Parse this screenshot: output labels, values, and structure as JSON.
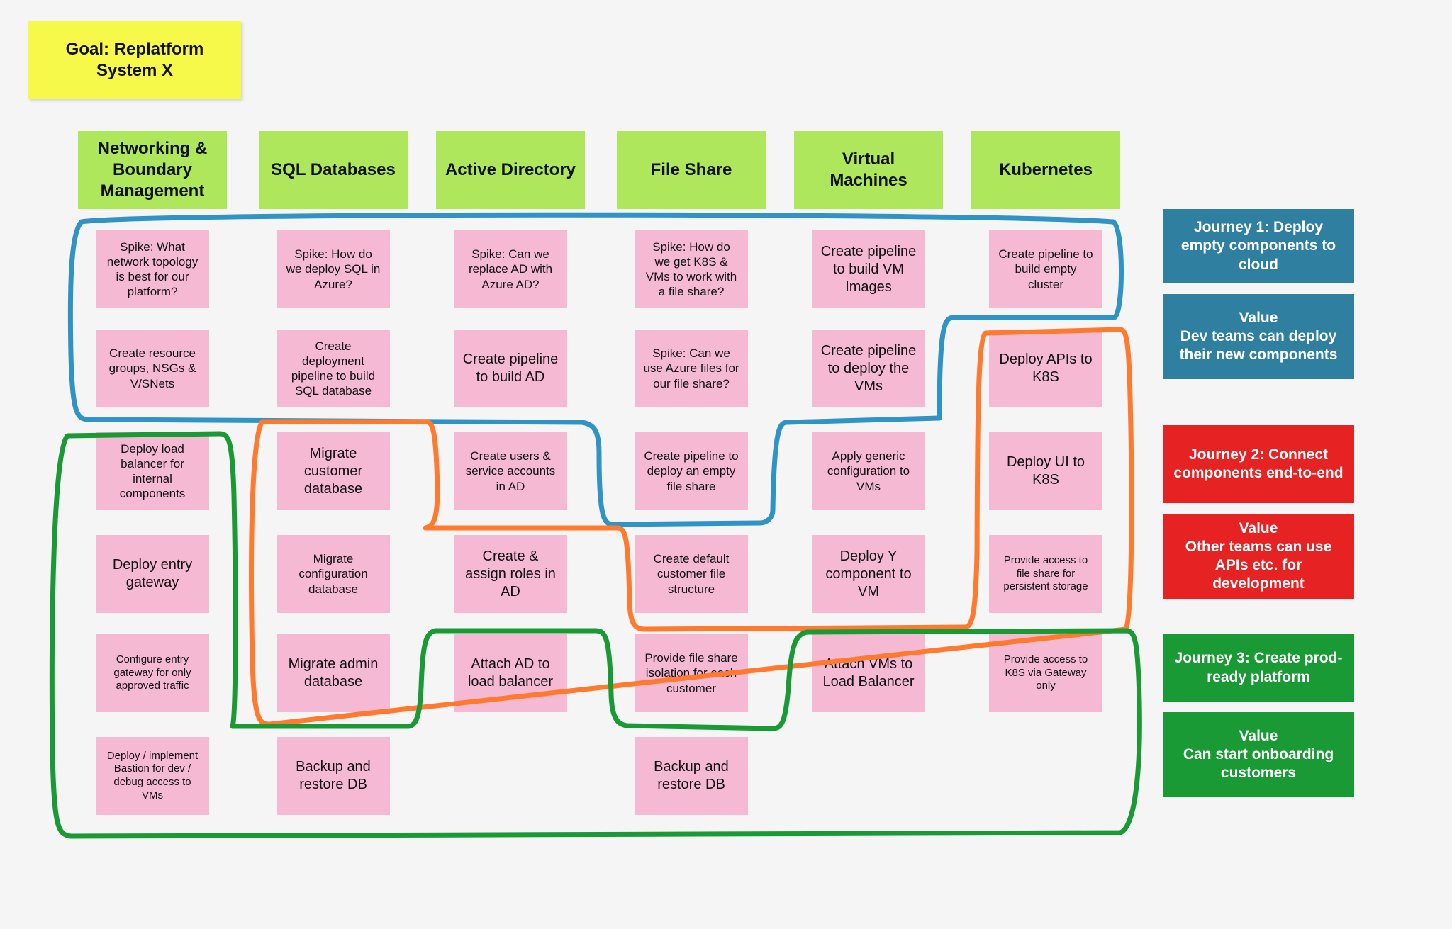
{
  "goal": "Goal: Replatform System X",
  "columns": [
    "Networking & Boundary Management",
    "SQL Databases",
    "Active Directory",
    "File Share",
    "Virtual Machines",
    "Kubernetes"
  ],
  "tasks": {
    "net": [
      "Spike: What network topology is best for our platform?",
      "Create resource groups, NSGs & V/SNets",
      "Deploy load balancer for internal components",
      "Deploy entry gateway",
      "Configure entry gateway for only approved traffic",
      "Deploy / implement Bastion for dev / debug access to VMs"
    ],
    "sql": [
      "Spike: How do we deploy SQL in Azure?",
      "Create deployment pipeline to build SQL database",
      "Migrate customer database",
      "Migrate configuration database",
      "Migrate admin database",
      "Backup and restore DB"
    ],
    "ad": [
      "Spike: Can we replace AD with Azure AD?",
      "Create pipeline to build AD",
      "Create users & service accounts in AD",
      "Create & assign roles in AD",
      "Attach AD to load balancer"
    ],
    "fs": [
      "Spike: How do we get K8S & VMs to work with a file share?",
      "Spike: Can we use Azure files for our file share?",
      "Create pipeline to deploy an empty file share",
      "Create default customer file structure",
      "Provide file share isolation for each customer",
      "Backup and restore DB"
    ],
    "vm": [
      "Create pipeline to build VM Images",
      "Create pipeline to deploy the VMs",
      "Apply generic configuration to VMs",
      "Deploy Y component to VM",
      "Attach VMs to Load Balancer"
    ],
    "k8s": [
      "Create pipeline to build empty cluster",
      "Deploy APIs to K8S",
      "Deploy UI to K8S",
      "Provide access to file share for persistent storage",
      "Provide access to K8S via Gateway only"
    ]
  },
  "journeys": [
    {
      "title": "Journey 1: Deploy empty components to cloud",
      "value": "Value\nDev teams can deploy their new components"
    },
    {
      "title": "Journey 2: Connect components end-to-end",
      "value": "Value\nOther teams can use APIs etc. for development"
    },
    {
      "title": "Journey 3: Create prod-ready platform",
      "value": "Value\nCan start onboarding customers"
    }
  ],
  "colors": {
    "goal_bg": "#f7f94a",
    "column_bg": "#aee75c",
    "task_bg": "#f6b9d4",
    "journey_blue": "#2f7fa1",
    "journey_red": "#e62222",
    "journey_green": "#1a9a35",
    "stroke_blue": "#2f94c5",
    "stroke_orange": "#ff7a2e",
    "stroke_green": "#1a9a35"
  }
}
